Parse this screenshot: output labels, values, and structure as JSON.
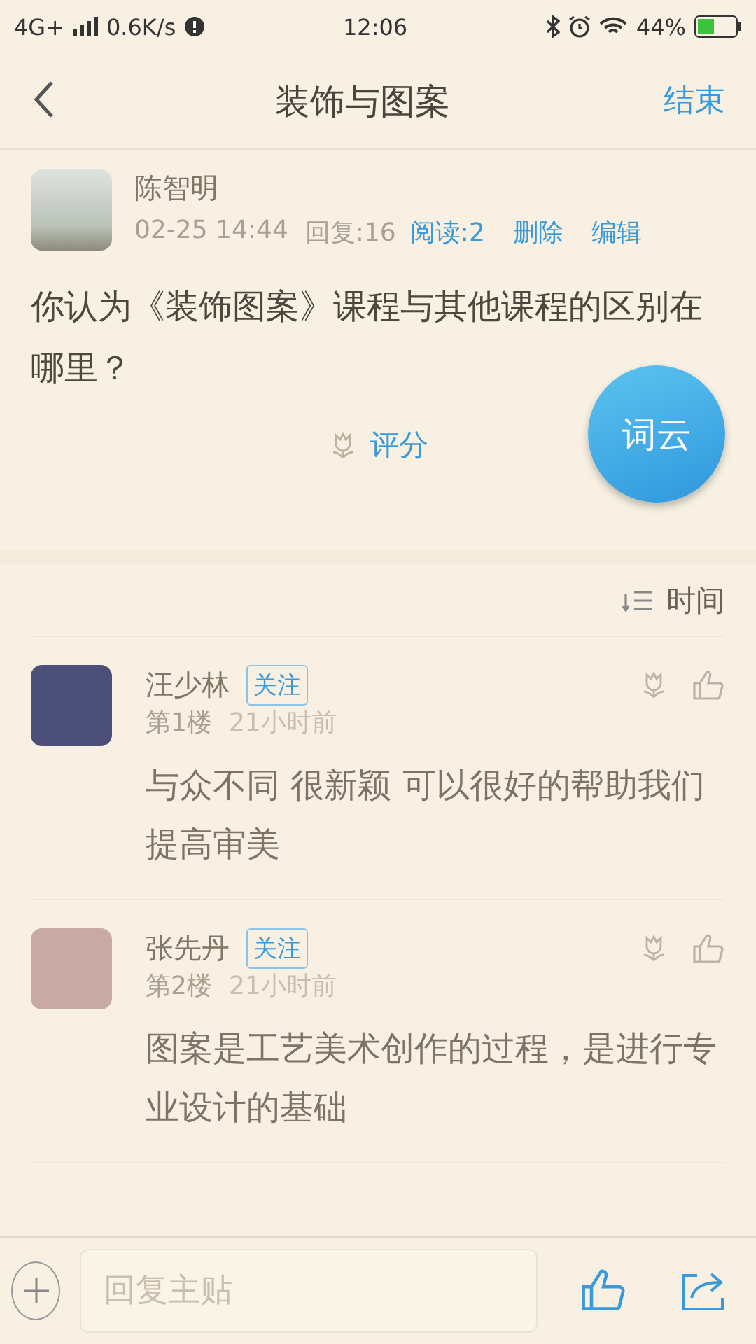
{
  "status_bar": {
    "network": "4G+",
    "speed": "0.6K/s",
    "time": "12:06",
    "battery": "44%"
  },
  "header": {
    "title": "装饰与图案",
    "action": "结束"
  },
  "post": {
    "author": "陈智明",
    "date": "02-25 14:44",
    "replies": "回复:16",
    "reads": "阅读:2",
    "delete": "删除",
    "edit": "编辑",
    "body": "你认为《装饰图案》课程与其他课程的区别在哪里？",
    "rate": "评分",
    "word_cloud": "词云"
  },
  "sort": {
    "label": "时间"
  },
  "comments": [
    {
      "name": "汪少林",
      "follow": "关注",
      "floor": "第1楼",
      "time": "21小时前",
      "body": "与众不同 很新颖 可以很好的帮助我们提高审美"
    },
    {
      "name": "张先丹",
      "follow": "关注",
      "floor": "第2楼",
      "time": "21小时前",
      "body": "图案是工艺美术创作的过程，是进行专业设计的基础"
    }
  ],
  "reply_bar": {
    "placeholder": "回复主贴"
  }
}
